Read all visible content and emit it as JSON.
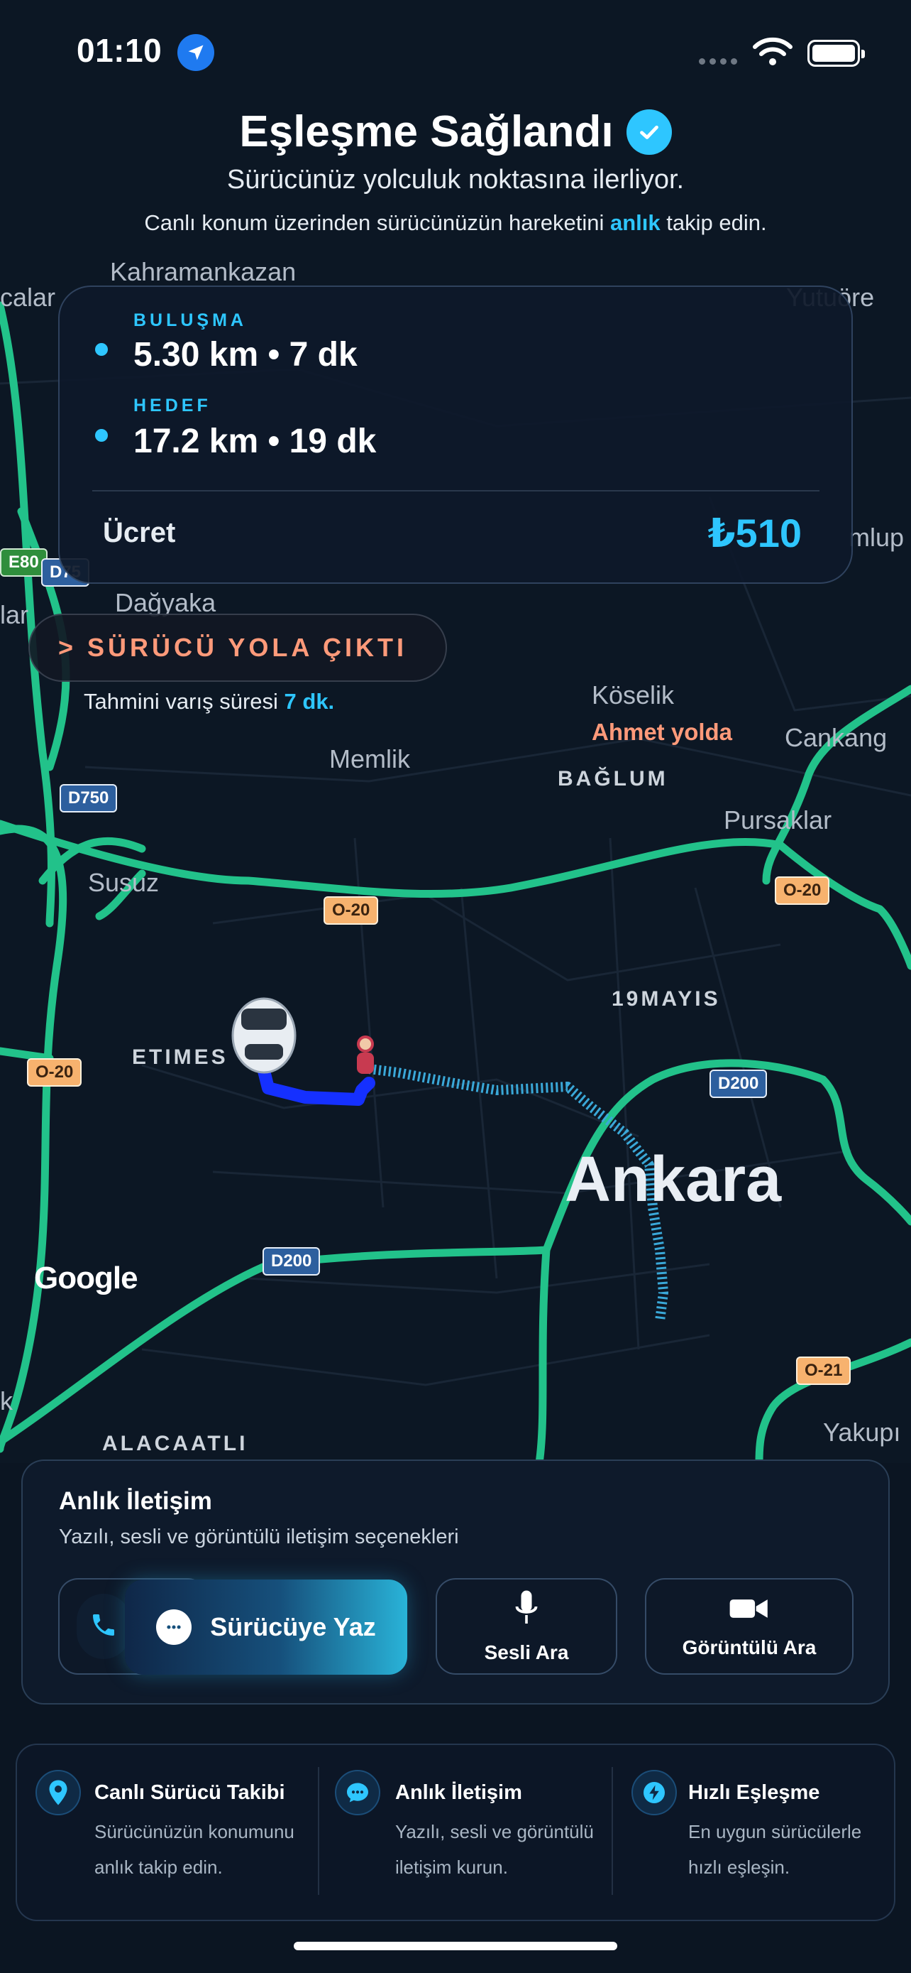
{
  "status_bar": {
    "time": "01:10"
  },
  "header": {
    "title": "Eşleşme Sağlandı",
    "subtitle": "Sürücünüz yolculuk noktasına ilerliyor.",
    "desc_before": "Canlı konum üzerinden sürücünüzün hareketini ",
    "desc_highlight": "anlık",
    "desc_after": " takip edin."
  },
  "map": {
    "places": {
      "kahramankazan": "Kahramankazan",
      "calar": "calar",
      "yuture": "Yutuöre",
      "lar": "lar",
      "dagyaka": "Dağyaka",
      "mlup": "mlup",
      "koselik": "Köselik",
      "cankaya": "Cankang",
      "memlik": "Memlik",
      "baglum": "BAĞLUM",
      "pursaklar": "Pursaklar",
      "susuz": "Susuz",
      "mayis": "19MAYIS",
      "etimes": "ETIMES",
      "ankara": "Ankara",
      "alacaatli": "ALACAATLI",
      "yakupi": "Yakupı",
      "k": "k"
    },
    "driver_label": "Ahmet yolda",
    "shields": {
      "e80": "E80",
      "d750a": "D75",
      "d750b": "D750",
      "o20a": "O-20",
      "o20b": "O-20",
      "o20c": "O-20",
      "d200a": "D200",
      "d200b": "D200",
      "o21": "O-21"
    },
    "google_logo": "Google"
  },
  "trip": {
    "pickup_tag": "BULUŞMA",
    "pickup_value": "5.30 km • 7 dk",
    "dest_tag": "HEDEF",
    "dest_value": "17.2 km • 19 dk",
    "fare_label": "Ücret",
    "fare_value": "₺510"
  },
  "driver_status": {
    "label": "> SÜRÜCÜ YOLA ÇIKTI",
    "eta_before": "Tahmini varış süresi ",
    "eta_highlight": "7 dk."
  },
  "communication": {
    "title": "Anlık İletişim",
    "subtitle": "Yazılı, sesli ve görüntülü iletişim seçenekleri",
    "write_label": "Sürücüye Yaz",
    "voice_label": "Sesli Ara",
    "video_label": "Görüntülü Ara"
  },
  "features": [
    {
      "icon": "location-pin-icon",
      "title": "Canlı Sürücü Takibi",
      "line1": "Sürücünüzün konumunu",
      "line2": "anlık takip edin."
    },
    {
      "icon": "chat-bubble-icon",
      "title": "Anlık İletişim",
      "line1": "Yazılı, sesli ve görüntülü",
      "line2": "iletişim kurun."
    },
    {
      "icon": "lightning-icon",
      "title": "Hızlı Eşleşme",
      "line1": "En uygun sürücülerle",
      "line2": "hızlı eşleşin."
    }
  ],
  "colors": {
    "accent": "#2ec6ff",
    "route_driver": "#1530ff",
    "route_trip": "#3aa8d8",
    "highway": "#22c28a",
    "status_text": "#ff9a7a",
    "background": "#0b1522"
  }
}
